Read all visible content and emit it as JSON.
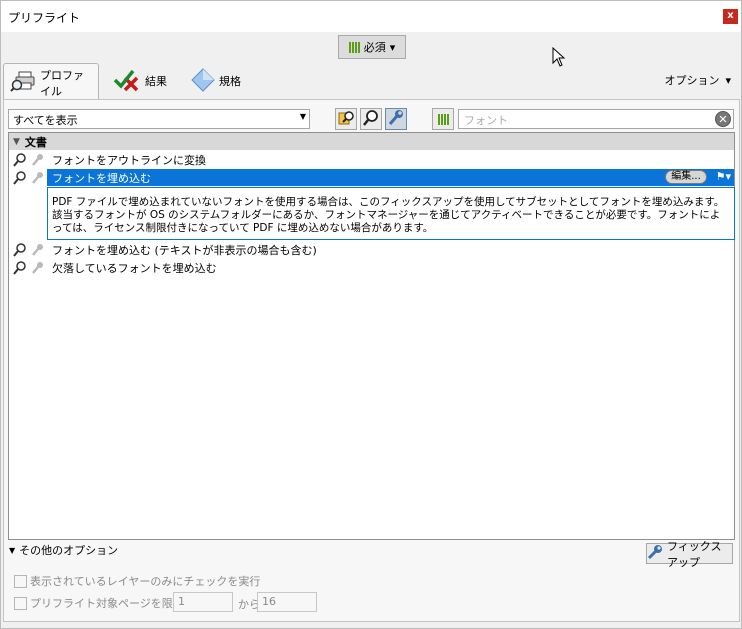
{
  "window": {
    "title": "プリフライト",
    "close_label": "x"
  },
  "filter_button": {
    "label": "必須",
    "caret": "▾",
    "icon": "bars-icon"
  },
  "tabs": [
    {
      "label": "プロファイル",
      "icon": "printer-magnifier-icon",
      "active": true
    },
    {
      "label": "結果",
      "icon": "checkmark-x-icon",
      "active": false
    },
    {
      "label": "規格",
      "icon": "diamond-icon",
      "active": false
    }
  ],
  "options_menu": {
    "label": "オプション",
    "caret": "▾"
  },
  "toolbar": {
    "filter_select": {
      "value": "すべてを表示"
    },
    "search": {
      "placeholder": "フォント",
      "clear_label": "✕"
    }
  },
  "list": {
    "group": {
      "label": "文書",
      "expander": "▼"
    },
    "rows": [
      {
        "label": "フォントをアウトラインに変換",
        "selected": false
      },
      {
        "label": "フォントを埋め込む",
        "selected": true,
        "edit_label": "編集...",
        "flag": "⚑▾"
      },
      {
        "label": "フォントを埋め込む (テキストが非表示の場合も含む)",
        "selected": false
      },
      {
        "label": "欠落しているフォントを埋め込む",
        "selected": false
      }
    ],
    "description": "PDF ファイルで埋め込まれていないフォントを使用する場合は、このフィックスアップを使用してサブセットとしてフォントを埋め込みます。該当するフォントが OS のシステムフォルダーにあるか、フォントマネージャーを通じてアクティベートできることが必要です。フォントによっては、ライセンス制限付きになっていて PDF に埋め込めない場合があります。"
  },
  "bottom": {
    "more_options": {
      "label": "その他のオプション",
      "expander": "▼"
    },
    "fixup_button": {
      "label": "フィックスアップ"
    },
    "check_visible_layers": {
      "label": "表示されているレイヤーのみにチェックを実行",
      "checked": false
    },
    "limit_pages": {
      "label": "プリフライト対象ページを限定：",
      "checked": false,
      "from_value": "1",
      "from_word": "から",
      "to_value": "16"
    }
  }
}
